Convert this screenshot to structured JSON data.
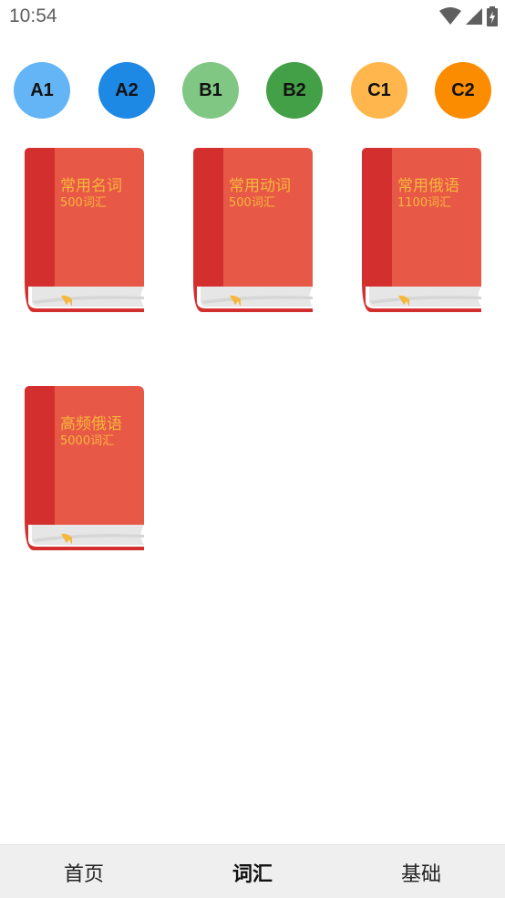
{
  "status_bar": {
    "time": "10:54",
    "icons": [
      "wifi-icon",
      "cell-signal-icon",
      "battery-charging-icon"
    ]
  },
  "levels": [
    {
      "label": "A1",
      "color": "#64b5f6"
    },
    {
      "label": "A2",
      "color": "#1e88e5"
    },
    {
      "label": "B1",
      "color": "#81c784"
    },
    {
      "label": "B2",
      "color": "#43a047"
    },
    {
      "label": "C1",
      "color": "#ffb74d"
    },
    {
      "label": "C2",
      "color": "#fb8c00"
    }
  ],
  "books": [
    {
      "title": "常用名词",
      "count": "500词汇"
    },
    {
      "title": "常用动词",
      "count": "500词汇"
    },
    {
      "title": "常用俄语",
      "count": "1100词汇"
    },
    {
      "title": "高频俄语",
      "count": "5000词汇"
    }
  ],
  "book_colors": {
    "spine": "#d32f2f",
    "cover": "#e85846",
    "pages": "#e6e6e6",
    "ribbon": "#f6b73c",
    "text": "#f6b73c"
  },
  "bottom_nav": {
    "items": [
      {
        "label": "首页"
      },
      {
        "label": "词汇"
      },
      {
        "label": "基础"
      }
    ],
    "active": "词汇"
  }
}
